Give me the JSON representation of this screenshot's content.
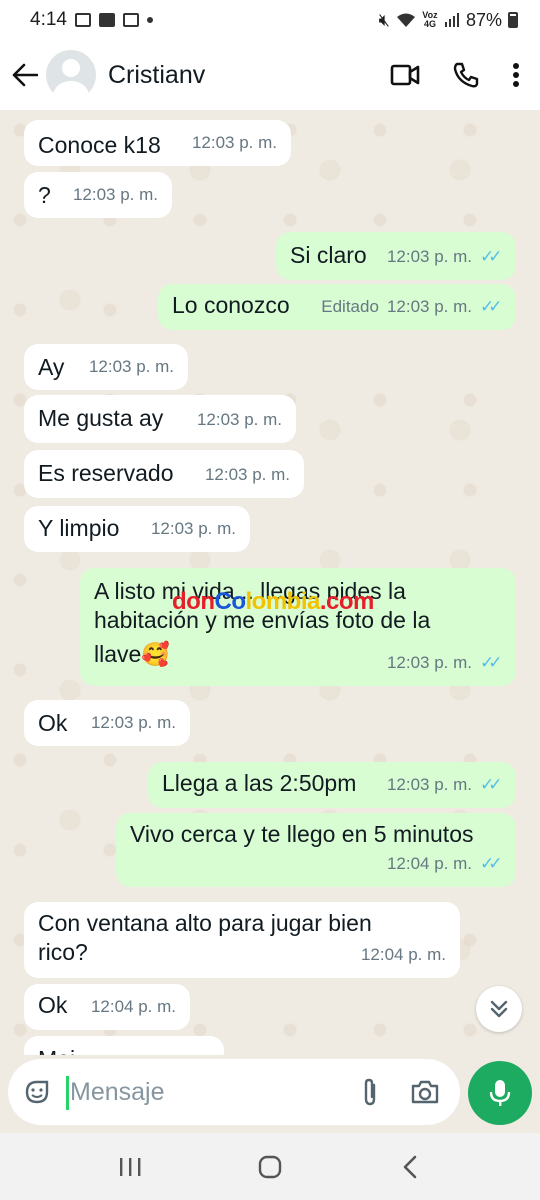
{
  "status_bar": {
    "time": "4:14",
    "network_label": "Voz 4G",
    "battery": "87%"
  },
  "header": {
    "contact_name": "Cristianv",
    "icons": [
      "back-arrow-icon",
      "video-call-icon",
      "voice-call-icon",
      "more-options-icon"
    ]
  },
  "messages": [
    {
      "dir": "in",
      "text": "Conoce k18",
      "time": "12:03 p. m."
    },
    {
      "dir": "in",
      "text": "?",
      "time": "12:03 p. m."
    },
    {
      "dir": "out",
      "text": "Si claro",
      "time": "12:03 p. m.",
      "status": "read"
    },
    {
      "dir": "out",
      "text": "Lo conozco",
      "time": "12:03 p. m.",
      "edited": "Editado",
      "status": "read"
    },
    {
      "dir": "in",
      "text": "Ay",
      "time": "12:03 p. m."
    },
    {
      "dir": "in",
      "text": "Me gusta ay",
      "time": "12:03 p. m."
    },
    {
      "dir": "in",
      "text": "Es reservado",
      "time": "12:03 p. m."
    },
    {
      "dir": "in",
      "text": "Y limpio",
      "time": "12:03 p. m."
    },
    {
      "dir": "out",
      "lines": [
        "A listo mi vida... llegas pides la",
        "habitación y me envías foto de la",
        "llave🥰"
      ],
      "time": "12:03 p. m.",
      "status": "read"
    },
    {
      "dir": "in",
      "text": "Ok",
      "time": "12:03 p. m."
    },
    {
      "dir": "out",
      "text": "Llega a las 2:50pm",
      "time": "12:03 p. m.",
      "status": "read"
    },
    {
      "dir": "out",
      "text": "Vivo cerca y te llego en 5 minutos",
      "time": "12:04 p. m.",
      "status": "read"
    },
    {
      "dir": "in",
      "lines": [
        "Con ventana alto para jugar bien",
        "rico?"
      ],
      "time": "12:04 p. m."
    },
    {
      "dir": "in",
      "text": "Ok",
      "time": "12:04 p. m."
    },
    {
      "dir": "in",
      "text": "Mej...",
      "time": ""
    }
  ],
  "watermark": {
    "part1": "don",
    "part2": "Co",
    "part3": "lombia",
    "part4": ".com"
  },
  "composer": {
    "placeholder": "Mensaje",
    "icons": [
      "sticker-icon",
      "attach-icon",
      "camera-icon",
      "mic-icon"
    ]
  },
  "colors": {
    "incoming_bubble": "#ffffff",
    "outgoing_bubble": "#d9fdd3",
    "chat_bg": "#efeae2",
    "read_ticks": "#53bdeb",
    "mic_button": "#1daa61"
  }
}
